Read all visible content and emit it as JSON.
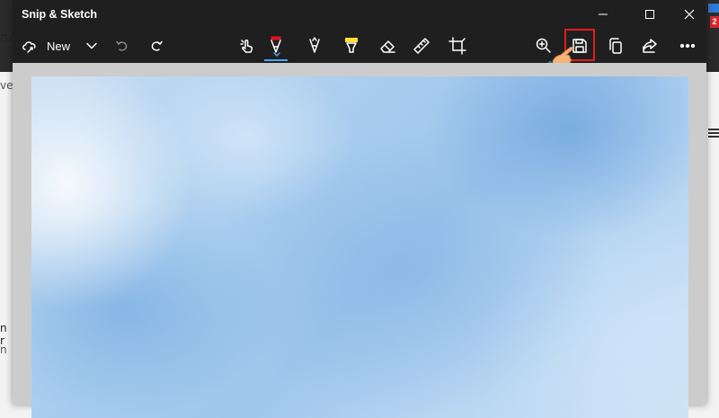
{
  "window": {
    "title": "Snip & Sketch"
  },
  "toolbar": {
    "new_label": "New"
  },
  "background_app": {
    "partial_left_text_1": "GA",
    "partial_left_text_2": "ve",
    "partial_left_text_3": "n r",
    "partial_left_text_4": "n",
    "badge": "2"
  },
  "icons": {
    "new": "new-snip-icon",
    "dropdown": "chevron-down-icon",
    "undo": "undo-icon",
    "redo": "redo-icon",
    "touch": "touch-writing-icon",
    "ballpoint": "ballpoint-pen-icon",
    "pencil": "pencil-icon",
    "highlighter": "highlighter-icon",
    "eraser": "eraser-icon",
    "ruler": "ruler-icon",
    "crop": "crop-icon",
    "zoom": "zoom-icon",
    "save": "save-icon",
    "copy": "copy-icon",
    "share": "share-icon",
    "more": "more-icon"
  },
  "colors": {
    "pen_red": "#e81123",
    "highlighter_yellow": "#ffe135",
    "highlight_box": "#e21b1b"
  }
}
